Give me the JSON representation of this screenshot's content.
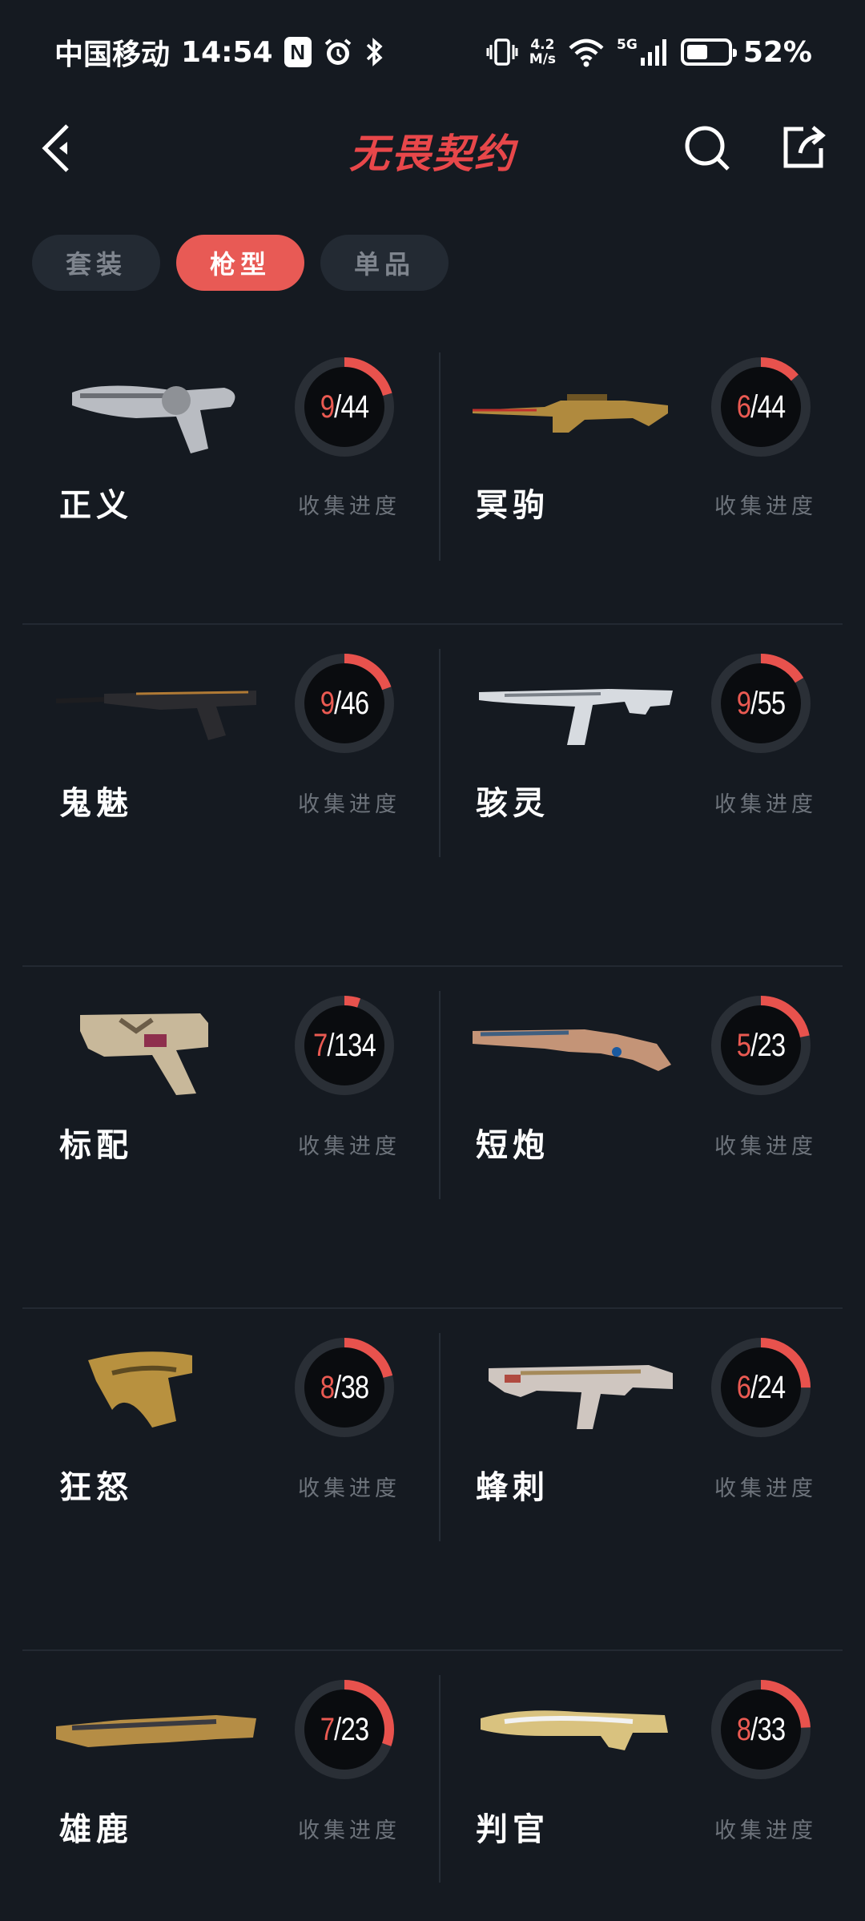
{
  "status_bar": {
    "carrier": "中国移动",
    "time": "14:54",
    "nfc_glyph": "N",
    "net_speed_value": "4.2",
    "net_speed_unit": "M/s",
    "network": "5G",
    "battery_percent": "52%",
    "battery_level": 0.52
  },
  "header": {
    "title": "无畏契约"
  },
  "tabs": [
    {
      "label": "套装",
      "active": false
    },
    {
      "label": "枪型",
      "active": true
    },
    {
      "label": "单品",
      "active": false
    }
  ],
  "progress_label": "收集进度",
  "weapons": [
    {
      "name": "正义",
      "owned": "9",
      "total": "44",
      "gun": "revolver-silver"
    },
    {
      "name": "冥驹",
      "owned": "6",
      "total": "44",
      "gun": "sniper-gold"
    },
    {
      "name": "鬼魅",
      "owned": "9",
      "total": "46",
      "gun": "pistol-suppressed"
    },
    {
      "name": "骇灵",
      "owned": "9",
      "total": "55",
      "gun": "smg-white"
    },
    {
      "name": "标配",
      "owned": "7",
      "total": "134",
      "gun": "pistol-tan"
    },
    {
      "name": "短炮",
      "owned": "5",
      "total": "23",
      "gun": "shotgun-pink"
    },
    {
      "name": "狂怒",
      "owned": "8",
      "total": "38",
      "gun": "pistol-gold"
    },
    {
      "name": "蜂刺",
      "owned": "6",
      "total": "24",
      "gun": "smg-silver"
    },
    {
      "name": "雄鹿",
      "owned": "7",
      "total": "23",
      "gun": "shotgun-gold"
    },
    {
      "name": "判官",
      "owned": "8",
      "total": "33",
      "gun": "shotgun-white-gold"
    }
  ],
  "colors": {
    "background": "#151a21",
    "accent": "#e85a55",
    "ring_track": "#2a2f36",
    "ring_fill": "#e8524d"
  }
}
